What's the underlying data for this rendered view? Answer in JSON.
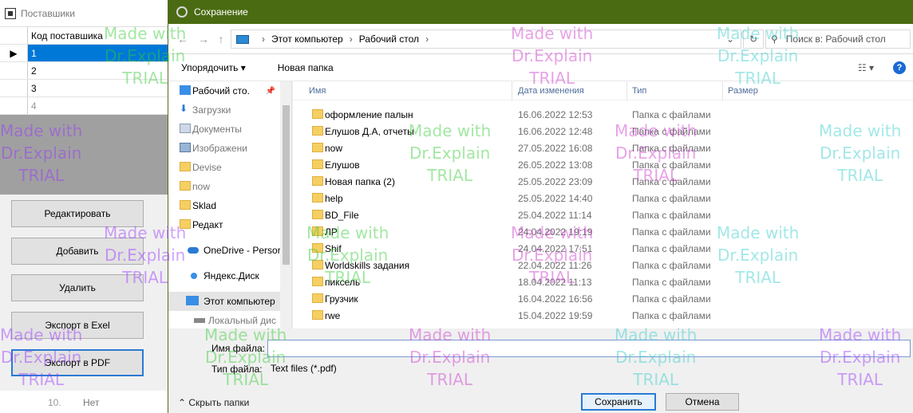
{
  "bg_app": {
    "title": "Поставшики",
    "grid_header": "Код поставшика",
    "rows": [
      "1",
      "2",
      "3",
      "4"
    ],
    "buttons": {
      "edit": "Редактировать",
      "add": "Добавить",
      "delete": "Удалить",
      "export_excel": "Экспорт в Exel",
      "export_pdf": "Экспорт в PDF"
    },
    "status_num": "10.",
    "status_text": "Нет"
  },
  "dialog": {
    "title": "Сохранение",
    "address": {
      "root": "Этот компьютер",
      "folder": "Рабочий стол"
    },
    "search_placeholder": "Поиск в: Рабочий стол",
    "toolbar": {
      "organize": "Упорядочить ▾",
      "new_folder": "Новая папка"
    },
    "nav_items": [
      {
        "label": "Рабочий сто.",
        "icon": "desktop-icon"
      },
      {
        "label": "Загрузки",
        "icon": "download-icon"
      },
      {
        "label": "Документы",
        "icon": "documents-icon"
      },
      {
        "label": "Изображени",
        "icon": "pictures-icon"
      },
      {
        "label": "Devise",
        "icon": "folder-icon"
      },
      {
        "label": "now",
        "icon": "folder-icon"
      },
      {
        "label": "Sklad",
        "icon": "folder-icon"
      },
      {
        "label": "Редакт",
        "icon": "folder-icon"
      },
      {
        "label": "OneDrive - Persor",
        "icon": "onedrive-icon"
      },
      {
        "label": "Яндекс.Диск",
        "icon": "yandex-disk-icon"
      },
      {
        "label": "Этот компьютер",
        "icon": "computer-icon"
      },
      {
        "label": "Локальный дис",
        "icon": "drive-icon"
      }
    ],
    "columns": {
      "name": "Имя",
      "date": "Дата изменения",
      "type": "Тип",
      "size": "Размер"
    },
    "files": [
      {
        "name": "оформление палын",
        "date": "16.06.2022 12:53",
        "type": "Папка с файлами"
      },
      {
        "name": "Елушов Д.А, отчеты",
        "date": "16.06.2022 12:48",
        "type": "Папка с файлами"
      },
      {
        "name": "now",
        "date": "27.05.2022 16:08",
        "type": "Папка с файлами"
      },
      {
        "name": "Елушов",
        "date": "26.05.2022 13:08",
        "type": "Папка с файлами"
      },
      {
        "name": "Новая папка (2)",
        "date": "25.05.2022 23:09",
        "type": "Папка с файлами"
      },
      {
        "name": "help",
        "date": "25.05.2022 14:40",
        "type": "Папка с файлами"
      },
      {
        "name": "BD_File",
        "date": "25.04.2022 11:14",
        "type": "Папка с файлами"
      },
      {
        "name": "ЛР",
        "date": "24.04.2022 19:19",
        "type": "Папка с файлами"
      },
      {
        "name": "Shif",
        "date": "24.04.2022 17:51",
        "type": "Папка с файлами"
      },
      {
        "name": "Worldskills задания",
        "date": "22.04.2022 11:26",
        "type": "Папка с файлами"
      },
      {
        "name": "пиксель",
        "date": "18.04.2022 11:13",
        "type": "Папка с файлами"
      },
      {
        "name": "Грузчик",
        "date": "16.04.2022 16:56",
        "type": "Папка с файлами"
      },
      {
        "name": "rwe",
        "date": "15.04.2022 19:59",
        "type": "Папка с файлами"
      }
    ],
    "filename_label": "Имя файла:",
    "filename_value": "",
    "filetype_label": "Тип файла:",
    "filetype_value": "Text files (*.pdf)",
    "hide_folders": "Скрыть папки",
    "save": "Сохранить",
    "cancel": "Отмена"
  },
  "watermark": {
    "line1": "Made with",
    "line2": "Dr.Explain",
    "line3": "TRIAL"
  },
  "colors": {
    "titlebar": "#4a6b12",
    "accent": "#2a7ad4",
    "folder": "#f6cf62"
  }
}
